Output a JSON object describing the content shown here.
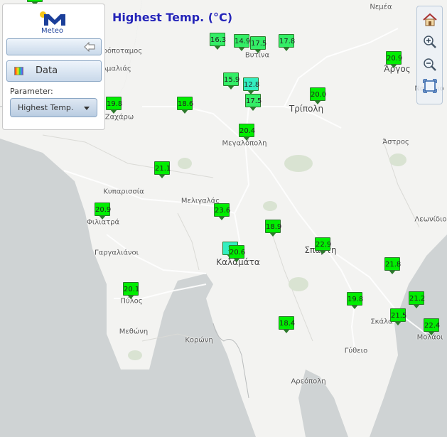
{
  "header": {
    "title": "Highest Temp. (°C)"
  },
  "panel": {
    "logo_text": "Meteo",
    "data_label": "Data",
    "parameter_label": "Parameter:",
    "parameter_value": "Highest Temp."
  },
  "icons": {
    "collapse": "arrow-left-icon",
    "data": "palette-icon",
    "home": "home-icon",
    "zoom_in": "zoom-in-icon",
    "zoom_out": "zoom-out-icon",
    "extent": "full-extent-icon"
  },
  "colors": {
    "title": "#2424b8",
    "marker_low": "#33ee66",
    "marker_high": "#00ee00",
    "marker_cool": "#33eec0"
  },
  "places": [
    {
      "id": "nemea",
      "name": "Νεμέα"
    },
    {
      "id": "xiropotamos",
      "name": "Ξηρόποταμος"
    },
    {
      "id": "amalias",
      "name": "Αμαλιάς"
    },
    {
      "id": "vytina",
      "name": "Βυτίνα"
    },
    {
      "id": "argos",
      "name": "Άργος"
    },
    {
      "id": "nafplio",
      "name": "Ναύπλιο"
    },
    {
      "id": "tripoli",
      "name": "Τρίπολη"
    },
    {
      "id": "zacharo",
      "name": "Ζαχάρω"
    },
    {
      "id": "megalopoli",
      "name": "Μεγαλόπολη"
    },
    {
      "id": "astros",
      "name": "Άστρος"
    },
    {
      "id": "kyparissia",
      "name": "Κυπαρισσία"
    },
    {
      "id": "meligalas",
      "name": "Μελιγαλάς"
    },
    {
      "id": "filiatra",
      "name": "Φιλιατρά"
    },
    {
      "id": "leonidio",
      "name": "Λεωνίδιο"
    },
    {
      "id": "gargalianoi",
      "name": "Γαργαλιάνοι"
    },
    {
      "id": "kalamata",
      "name": "Καλαμάτα"
    },
    {
      "id": "sparti",
      "name": "Σπάρτη"
    },
    {
      "id": "pylos",
      "name": "Πύλος"
    },
    {
      "id": "skala",
      "name": "Σκάλα"
    },
    {
      "id": "methoni",
      "name": "Μεθώνη"
    },
    {
      "id": "molaoi",
      "name": "Μολάοι"
    },
    {
      "id": "koroni",
      "name": "Κορώνη"
    },
    {
      "id": "gytheio",
      "name": "Γύθειο"
    },
    {
      "id": "areopoli",
      "name": "Αρεόπολη"
    }
  ],
  "stations": [
    {
      "id": "top-partial",
      "value": "22.9"
    },
    {
      "id": "s163",
      "value": "16.3"
    },
    {
      "id": "s149",
      "value": "14.9"
    },
    {
      "id": "s175a",
      "value": "17.5"
    },
    {
      "id": "s178",
      "value": "17.8"
    },
    {
      "id": "s209a",
      "value": "20.9"
    },
    {
      "id": "s159",
      "value": "15.9"
    },
    {
      "id": "s128",
      "value": "12.8"
    },
    {
      "id": "s175b",
      "value": "17.5"
    },
    {
      "id": "s200",
      "value": "20.0"
    },
    {
      "id": "s198a",
      "value": "19.8"
    },
    {
      "id": "s186",
      "value": "18.6"
    },
    {
      "id": "s204",
      "value": "20.4"
    },
    {
      "id": "s211",
      "value": "21.1"
    },
    {
      "id": "s209b",
      "value": "20.9"
    },
    {
      "id": "s236",
      "value": "23.6"
    },
    {
      "id": "s189",
      "value": "18.9"
    },
    {
      "id": "s229",
      "value": "22.9"
    },
    {
      "id": "s2xa",
      "value": "2"
    },
    {
      "id": "s206",
      "value": "20.6"
    },
    {
      "id": "s218",
      "value": "21.8"
    },
    {
      "id": "s201",
      "value": "20.1"
    },
    {
      "id": "s198b",
      "value": "19.8"
    },
    {
      "id": "s212",
      "value": "21.2"
    },
    {
      "id": "s215",
      "value": "21.5"
    },
    {
      "id": "s184",
      "value": "18.4"
    },
    {
      "id": "s224",
      "value": "22.4"
    }
  ]
}
